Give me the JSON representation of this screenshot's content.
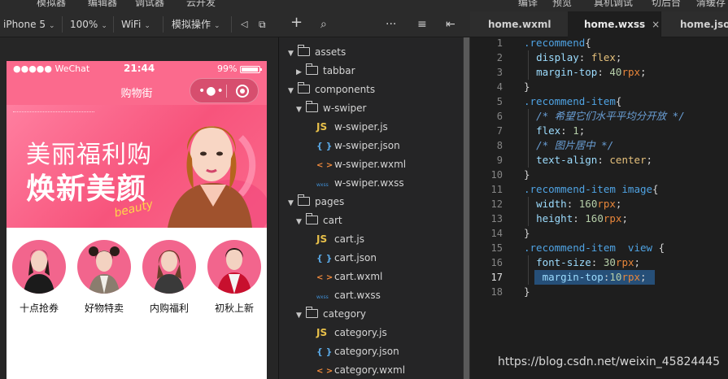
{
  "menubar": {
    "items": [
      "模拟器",
      "编辑器",
      "调试器",
      "云开发"
    ],
    "right_items": [
      "编译",
      "预览",
      "真机调试",
      "切后台",
      "清缓存"
    ]
  },
  "sim_toolbar": {
    "device": "iPhone 5",
    "zoom": "100%",
    "network": "WiFi",
    "operation": "模拟操作"
  },
  "phone": {
    "status": {
      "carrier": "●●●●● WeChat",
      "time": "21:44",
      "battery": "99%"
    },
    "nav_title": "购物街",
    "banner": {
      "line1": "美丽福利购",
      "line2": "焕新美颜",
      "script": "beauty"
    },
    "recommend": [
      {
        "label": "十点抢券"
      },
      {
        "label": "好物特卖"
      },
      {
        "label": "内购福利"
      },
      {
        "label": "初秋上新"
      }
    ]
  },
  "tree_toolbar": {
    "add": "+",
    "search": "⌕",
    "more": "···",
    "sort": "≡",
    "collapse": "⇤"
  },
  "tree": [
    {
      "label": "assets",
      "type": "folder",
      "expanded": true,
      "depth": 0
    },
    {
      "label": "tabbar",
      "type": "folder",
      "expanded": false,
      "depth": 1
    },
    {
      "label": "components",
      "type": "folder",
      "expanded": true,
      "depth": 0
    },
    {
      "label": "w-swiper",
      "type": "folder",
      "expanded": true,
      "depth": 1
    },
    {
      "label": "w-swiper.js",
      "type": "js",
      "icon": "JS",
      "depth": 2
    },
    {
      "label": "w-swiper.json",
      "type": "json",
      "icon": "{ }",
      "depth": 2
    },
    {
      "label": "w-swiper.wxml",
      "type": "wxml",
      "icon": "< >",
      "depth": 2
    },
    {
      "label": "w-swiper.wxss",
      "type": "wxss",
      "icon": "wxss",
      "depth": 2
    },
    {
      "label": "pages",
      "type": "folder",
      "expanded": true,
      "depth": 0
    },
    {
      "label": "cart",
      "type": "folder",
      "expanded": true,
      "depth": 1
    },
    {
      "label": "cart.js",
      "type": "js",
      "icon": "JS",
      "depth": 2
    },
    {
      "label": "cart.json",
      "type": "json",
      "icon": "{ }",
      "depth": 2
    },
    {
      "label": "cart.wxml",
      "type": "wxml",
      "icon": "< >",
      "depth": 2
    },
    {
      "label": "cart.wxss",
      "type": "wxss",
      "icon": "wxss",
      "depth": 2
    },
    {
      "label": "category",
      "type": "folder",
      "expanded": true,
      "depth": 1
    },
    {
      "label": "category.js",
      "type": "js",
      "icon": "JS",
      "depth": 2
    },
    {
      "label": "category.json",
      "type": "json",
      "icon": "{ }",
      "depth": 2
    },
    {
      "label": "category.wxml",
      "type": "wxml",
      "icon": "< >",
      "depth": 2
    }
  ],
  "tabs": [
    {
      "label": "home.wxml",
      "active": false
    },
    {
      "label": "home.wxss",
      "active": true,
      "close": "×"
    },
    {
      "label": "home.json",
      "active": false
    }
  ],
  "code": {
    "lines": [
      {
        "n": "1",
        "tokens": [
          [
            "t-sel",
            ".recommend"
          ],
          [
            "t-brace",
            "{"
          ]
        ]
      },
      {
        "n": "2",
        "tokens": [
          [
            "t-punc",
            "  "
          ],
          [
            "t-prop",
            "display"
          ],
          [
            "t-punc",
            ": "
          ],
          [
            "t-val",
            "flex"
          ],
          [
            "t-punc",
            ";"
          ]
        ]
      },
      {
        "n": "3",
        "tokens": [
          [
            "t-punc",
            "  "
          ],
          [
            "t-prop",
            "margin-top"
          ],
          [
            "t-punc",
            ": "
          ],
          [
            "t-num",
            "40"
          ],
          [
            "t-unit",
            "rpx"
          ],
          [
            "t-punc",
            ";"
          ]
        ]
      },
      {
        "n": "4",
        "tokens": [
          [
            "t-brace",
            "}"
          ]
        ]
      },
      {
        "n": "5",
        "tokens": [
          [
            "t-sel",
            ".recommend-item"
          ],
          [
            "t-brace",
            "{"
          ]
        ]
      },
      {
        "n": "6",
        "tokens": [
          [
            "t-punc",
            "  "
          ],
          [
            "t-cmt",
            "/* 希望它们水平平均分开放 */"
          ]
        ]
      },
      {
        "n": "7",
        "tokens": [
          [
            "t-punc",
            "  "
          ],
          [
            "t-prop",
            "flex"
          ],
          [
            "t-punc",
            ": "
          ],
          [
            "t-num",
            "1"
          ],
          [
            "t-punc",
            ";"
          ]
        ]
      },
      {
        "n": "8",
        "tokens": [
          [
            "t-punc",
            "  "
          ],
          [
            "t-cmt",
            "/* 图片居中 */"
          ]
        ]
      },
      {
        "n": "9",
        "tokens": [
          [
            "t-punc",
            "  "
          ],
          [
            "t-prop",
            "text-align"
          ],
          [
            "t-punc",
            ": "
          ],
          [
            "t-val",
            "center"
          ],
          [
            "t-punc",
            ";"
          ]
        ]
      },
      {
        "n": "10",
        "tokens": [
          [
            "t-brace",
            "}"
          ]
        ]
      },
      {
        "n": "11",
        "tokens": [
          [
            "t-sel",
            ".recommend-item image"
          ],
          [
            "t-brace",
            "{"
          ]
        ]
      },
      {
        "n": "12",
        "tokens": [
          [
            "t-punc",
            "  "
          ],
          [
            "t-prop",
            "width"
          ],
          [
            "t-punc",
            ": "
          ],
          [
            "t-num",
            "160"
          ],
          [
            "t-unit",
            "rpx"
          ],
          [
            "t-punc",
            ";"
          ]
        ]
      },
      {
        "n": "13",
        "tokens": [
          [
            "t-punc",
            "  "
          ],
          [
            "t-prop",
            "height"
          ],
          [
            "t-punc",
            ": "
          ],
          [
            "t-num",
            "160"
          ],
          [
            "t-unit",
            "rpx"
          ],
          [
            "t-punc",
            ";"
          ]
        ]
      },
      {
        "n": "14",
        "tokens": [
          [
            "t-brace",
            "}"
          ]
        ]
      },
      {
        "n": "15",
        "tokens": [
          [
            "t-sel",
            ".recommend-item  view "
          ],
          [
            "t-brace",
            "{"
          ]
        ]
      },
      {
        "n": "16",
        "tokens": [
          [
            "t-punc",
            "  "
          ],
          [
            "t-prop",
            "font-size"
          ],
          [
            "t-punc",
            ": "
          ],
          [
            "t-num",
            "30"
          ],
          [
            "t-unit",
            "rpx"
          ],
          [
            "t-punc",
            ";"
          ]
        ]
      },
      {
        "n": "17",
        "tokens": [
          [
            "t-punc",
            "   "
          ],
          [
            "t-prop",
            "margin-top"
          ],
          [
            "t-punc",
            ":"
          ],
          [
            "t-num",
            "10"
          ],
          [
            "t-unit",
            "rpx"
          ],
          [
            "t-punc",
            ";"
          ]
        ]
      },
      {
        "n": "18",
        "tokens": [
          [
            "t-brace",
            "}"
          ]
        ]
      }
    ]
  },
  "watermark": "https://blog.csdn.net/weixin_45824445",
  "colors": {
    "accent_pink": "#fb6a8d",
    "editor_bg": "#1e1e1e",
    "selection": "#264f78"
  }
}
